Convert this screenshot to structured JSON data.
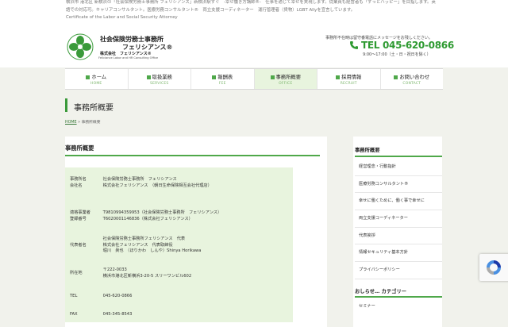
{
  "intro": {
    "line1": "横浜市 港北区 新横浜の「社会保険労務士事務所 フェリシアンス」新横浜駅すぐ　-幸せ働き方講師®-　仕事を通じて幸せを実現します。従業員も経営者も「ずっとハッピー」を目指します。英語での対応可。キャリアコンサルタント。医療労務コンサルタント®　両立支援コーディネーター　運行管理者（貨物）LGBT Allyを宣言しています。",
    "line2": "Certificate of the Labor and Social Security Attorney"
  },
  "logo": {
    "line1": "社会保険労務士事務所",
    "line2": "フェリシアンス®",
    "line3": "株式会社　フェリシアンス®",
    "line4": "Feliciance Labor and HR Consulting Office"
  },
  "contact": {
    "note": "事務所不在時は留守番電話にメッセージをお残しください。",
    "tel": "TEL 045-620-0866",
    "hours": "9:00〜17:00（土・日・祝日を除く）"
  },
  "nav": [
    {
      "label": "ホーム",
      "en": "HOME"
    },
    {
      "label": "取扱業務",
      "en": "SERVICES"
    },
    {
      "label": "報酬表",
      "en": "FEE"
    },
    {
      "label": "事務所概要",
      "en": "OFFICE"
    },
    {
      "label": "採用情報",
      "en": "RECRUIT"
    },
    {
      "label": "お問い合わせ",
      "en": "CONTACT"
    }
  ],
  "page_title": "事務所概要",
  "breadcrumb": {
    "home": "HOME",
    "sep": "»",
    "current": "事務所概要"
  },
  "main": {
    "heading": "事務所概要",
    "rows": [
      {
        "label1": "事務所名",
        "label2": "会社名",
        "value1": "社会保険労務士事務所　フェリシアンス",
        "value2": "株式会社フェリシアンス　（朝日生命保険相互会社代理店）"
      },
      {
        "label1": "適格事業者",
        "label2": "登録番号",
        "value1": "T9810994359953（社会保険労務士事務所　フェリシアンス）",
        "value2": "T6020001146836（株式会社フェリシアンス）"
      },
      {
        "label1": "代表者名",
        "value1": "社会保険労務士事務所フェリシアンス　代表",
        "value2": "株式会社フェリシアンス　代表取締役",
        "value3": "堀川　眞也　（ほりかわ　しんや）Shinya Horikawa"
      },
      {
        "label1": "所在地",
        "value1": "〒222-0033",
        "value2": "横浜市港北区新横浜3-20-5 スリーワンビル602"
      },
      {
        "label1": "TEL",
        "value1": "045-620-0866"
      },
      {
        "label1": "FAX",
        "value1": "045-345-8543"
      }
    ]
  },
  "sidebar": {
    "heading": "事務所概要",
    "items": [
      "経営理念・行動指針",
      "医療労務コンサルタント®",
      "幸せに働くために、働く事で幸せに",
      "両立支援コーディネーター",
      "代表挨拶",
      "情報セキュリティ基本方針",
      "プライバシーポリシー"
    ],
    "heading2": "おしらせ… カテゴリー",
    "item2": "セミナー"
  },
  "colors": {
    "accent": "#4fa84a",
    "tel": "#2e9a31",
    "table_bg": "#e8f4de",
    "page_bg": "#f1f2ec"
  },
  "icons": {
    "logo": "clover-logo-icon",
    "phone": "phone-icon",
    "recaptcha": "recaptcha-icon"
  }
}
